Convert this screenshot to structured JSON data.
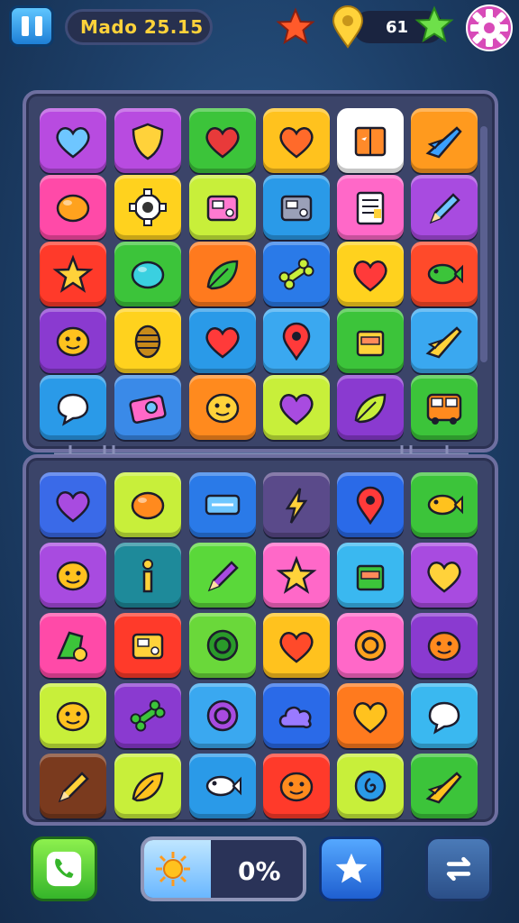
{
  "header": {
    "title": "Mado 25.15",
    "counter": "61",
    "icons": [
      "pause-icon",
      "red-star-icon",
      "map-pin-icon",
      "green-star-icon",
      "gear-icon"
    ]
  },
  "boards": {
    "top": [
      {
        "color": "#b84be0",
        "icon": "heart",
        "fg": "#6ec6ff"
      },
      {
        "color": "#b84be0",
        "icon": "shield",
        "fg": "#ffd23a"
      },
      {
        "color": "#3cc43a",
        "icon": "heart",
        "fg": "#e83a3a"
      },
      {
        "color": "#ffc21e",
        "icon": "heart",
        "fg": "#ff6a2a"
      },
      {
        "color": "#ffffff",
        "icon": "book",
        "fg": "#ff8a2a"
      },
      {
        "color": "#ff9a1e",
        "icon": "plane",
        "fg": "#3aa0ff"
      },
      {
        "color": "#ff4aa8",
        "icon": "blob",
        "fg": "#ffa21e"
      },
      {
        "color": "#ffd21e",
        "icon": "gear",
        "fg": "#333333"
      },
      {
        "color": "#c8ef3a",
        "icon": "machine",
        "fg": "#ff7ad0"
      },
      {
        "color": "#2a9ae8",
        "icon": "machine",
        "fg": "#9aa0b8"
      },
      {
        "color": "#ff68c8",
        "icon": "paper",
        "fg": "#ffd23a"
      },
      {
        "color": "#a84be0",
        "icon": "pencil",
        "fg": "#6ec6ff"
      },
      {
        "color": "#ff3a2a",
        "icon": "star",
        "fg": "#ffd23a"
      },
      {
        "color": "#3cc43a",
        "icon": "blob",
        "fg": "#3ad0e0"
      },
      {
        "color": "#ff7a1e",
        "icon": "leaf",
        "fg": "#3cc43a"
      },
      {
        "color": "#2a7ae8",
        "icon": "bone",
        "fg": "#c8ef3a"
      },
      {
        "color": "#ffd21e",
        "icon": "heart",
        "fg": "#ff3a3a"
      },
      {
        "color": "#ff4a2a",
        "icon": "fish",
        "fg": "#3cc43a"
      },
      {
        "color": "#8a3ad0",
        "icon": "face",
        "fg": "#ffc21e"
      },
      {
        "color": "#ffd21e",
        "icon": "hive",
        "fg": "#c88a1a"
      },
      {
        "color": "#2a9ae8",
        "icon": "heart",
        "fg": "#ff3a3a"
      },
      {
        "color": "#3aa8f0",
        "icon": "pin",
        "fg": "#ff3a3a"
      },
      {
        "color": "#3cc43a",
        "icon": "box",
        "fg": "#ffd23a"
      },
      {
        "color": "#3aa8f0",
        "icon": "plane",
        "fg": "#ffd23a"
      },
      {
        "color": "#2a9ae8",
        "icon": "bubble",
        "fg": "#ffffff"
      },
      {
        "color": "#3a8ae8",
        "icon": "camera",
        "fg": "#ff68c8"
      },
      {
        "color": "#ff8a1e",
        "icon": "face",
        "fg": "#ffd23a"
      },
      {
        "color": "#c8ef3a",
        "icon": "heart",
        "fg": "#a84be0"
      },
      {
        "color": "#8a3ad0",
        "icon": "leaf",
        "fg": "#c8ef3a"
      },
      {
        "color": "#3cc43a",
        "icon": "bus",
        "fg": "#ff8a1e"
      }
    ],
    "bottom": [
      {
        "color": "#3a6ae8",
        "icon": "heart",
        "fg": "#a84be0"
      },
      {
        "color": "#c8ef3a",
        "icon": "blob",
        "fg": "#ff8a1e"
      },
      {
        "color": "#2a7ae8",
        "icon": "rect",
        "fg": "#6ec6ff"
      },
      {
        "color": "#5a4a8a",
        "icon": "bolt",
        "fg": "#ffd23a"
      },
      {
        "color": "#2a6ae8",
        "icon": "pin",
        "fg": "#ff3a3a"
      },
      {
        "color": "#3cc43a",
        "icon": "fish",
        "fg": "#ffc21e"
      },
      {
        "color": "#a84be0",
        "icon": "face",
        "fg": "#ffc21e"
      },
      {
        "color": "#1e8a9a",
        "icon": "info",
        "fg": "#ffd23a"
      },
      {
        "color": "#5ad83a",
        "icon": "pencil",
        "fg": "#a84be0"
      },
      {
        "color": "#ff68c8",
        "icon": "star",
        "fg": "#ffd23a"
      },
      {
        "color": "#3ab8f0",
        "icon": "box",
        "fg": "#3cc43a"
      },
      {
        "color": "#a84be0",
        "icon": "heart",
        "fg": "#ffd23a"
      },
      {
        "color": "#ff4aa8",
        "icon": "tool",
        "fg": "#3cc43a"
      },
      {
        "color": "#ff3a2a",
        "icon": "machine",
        "fg": "#ffd23a"
      },
      {
        "color": "#6ad83a",
        "icon": "ring",
        "fg": "#2a9a2a"
      },
      {
        "color": "#ffc21e",
        "icon": "heart",
        "fg": "#ff4a2a"
      },
      {
        "color": "#ff68c8",
        "icon": "ring",
        "fg": "#ffa21e"
      },
      {
        "color": "#8a3ad0",
        "icon": "face",
        "fg": "#ff8a1e"
      },
      {
        "color": "#c8ef3a",
        "icon": "face",
        "fg": "#ffc21e"
      },
      {
        "color": "#8a3ad0",
        "icon": "bone",
        "fg": "#3cc43a"
      },
      {
        "color": "#3aa8f0",
        "icon": "ring",
        "fg": "#a84be0"
      },
      {
        "color": "#2a6ae8",
        "icon": "cloud",
        "fg": "#9a7aff"
      },
      {
        "color": "#ff7a1e",
        "icon": "heart",
        "fg": "#ffc21e"
      },
      {
        "color": "#3ab8f0",
        "icon": "bubble",
        "fg": "#ffffff"
      },
      {
        "color": "#7a3a1e",
        "icon": "pencil",
        "fg": "#ffd23a"
      },
      {
        "color": "#c8ef3a",
        "icon": "leaf",
        "fg": "#ffc21e"
      },
      {
        "color": "#2a9ae8",
        "icon": "fish",
        "fg": "#ffffff"
      },
      {
        "color": "#ff3a2a",
        "icon": "face",
        "fg": "#ff8a1e"
      },
      {
        "color": "#c8ef3a",
        "icon": "swirl",
        "fg": "#2a9ae8"
      },
      {
        "color": "#3cc43a",
        "icon": "plane",
        "fg": "#ffc21e"
      }
    ]
  },
  "footer": {
    "progress_value": 0.42,
    "progress_text": "0%",
    "icons": [
      "phone-icon",
      "sun-icon",
      "star-icon",
      "swap-icon"
    ]
  }
}
